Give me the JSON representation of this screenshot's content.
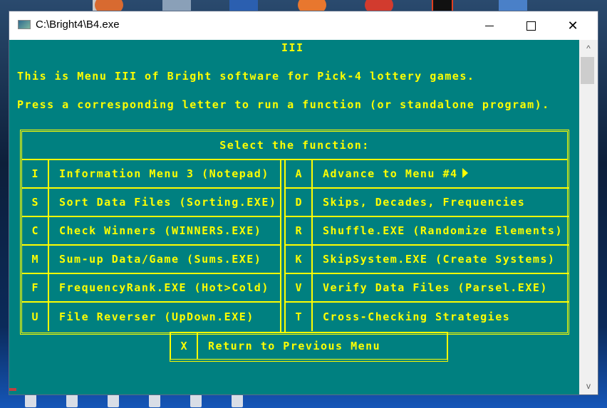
{
  "window": {
    "title": "C:\\Bright4\\B4.exe",
    "controls": {
      "minimize": "minimize",
      "maximize": "maximize",
      "close": "✕"
    }
  },
  "console": {
    "menu_id": "III",
    "intro_line_1": "This is Menu III of Bright software for Pick-4 lottery games.",
    "intro_line_2": "Press a corresponding letter to run a function (or standalone program).",
    "menu_header": "Select the function:",
    "left_items": [
      {
        "key": "I",
        "label": "Information Menu 3 (Notepad)"
      },
      {
        "key": "S",
        "label": "Sort Data Files (Sorting.EXE)"
      },
      {
        "key": "C",
        "label": "Check Winners (WINNERS.EXE)"
      },
      {
        "key": "M",
        "label": "Sum-up Data/Game (Sums.EXE)"
      },
      {
        "key": "F",
        "label": "FrequencyRank.EXE (Hot>Cold)"
      },
      {
        "key": "U",
        "label": "File Reverser (UpDown.EXE)"
      }
    ],
    "right_items": [
      {
        "key": "A",
        "label": "Advance to Menu #4"
      },
      {
        "key": "D",
        "label": "Skips, Decades, Frequencies"
      },
      {
        "key": "R",
        "label": "Shuffle.EXE (Randomize Elements)"
      },
      {
        "key": "K",
        "label": "SkipSystem.EXE (Create Systems)"
      },
      {
        "key": "V",
        "label": "Verify Data Files (Parsel.EXE)"
      },
      {
        "key": "T",
        "label": "Cross-Checking Strategies"
      }
    ],
    "return_item": {
      "key": "X",
      "label": "Return to Previous Menu"
    }
  },
  "scrollbar": {
    "up": "^",
    "down": "v"
  },
  "colors": {
    "console_bg": "#008080",
    "console_fg": "#ffff00"
  }
}
